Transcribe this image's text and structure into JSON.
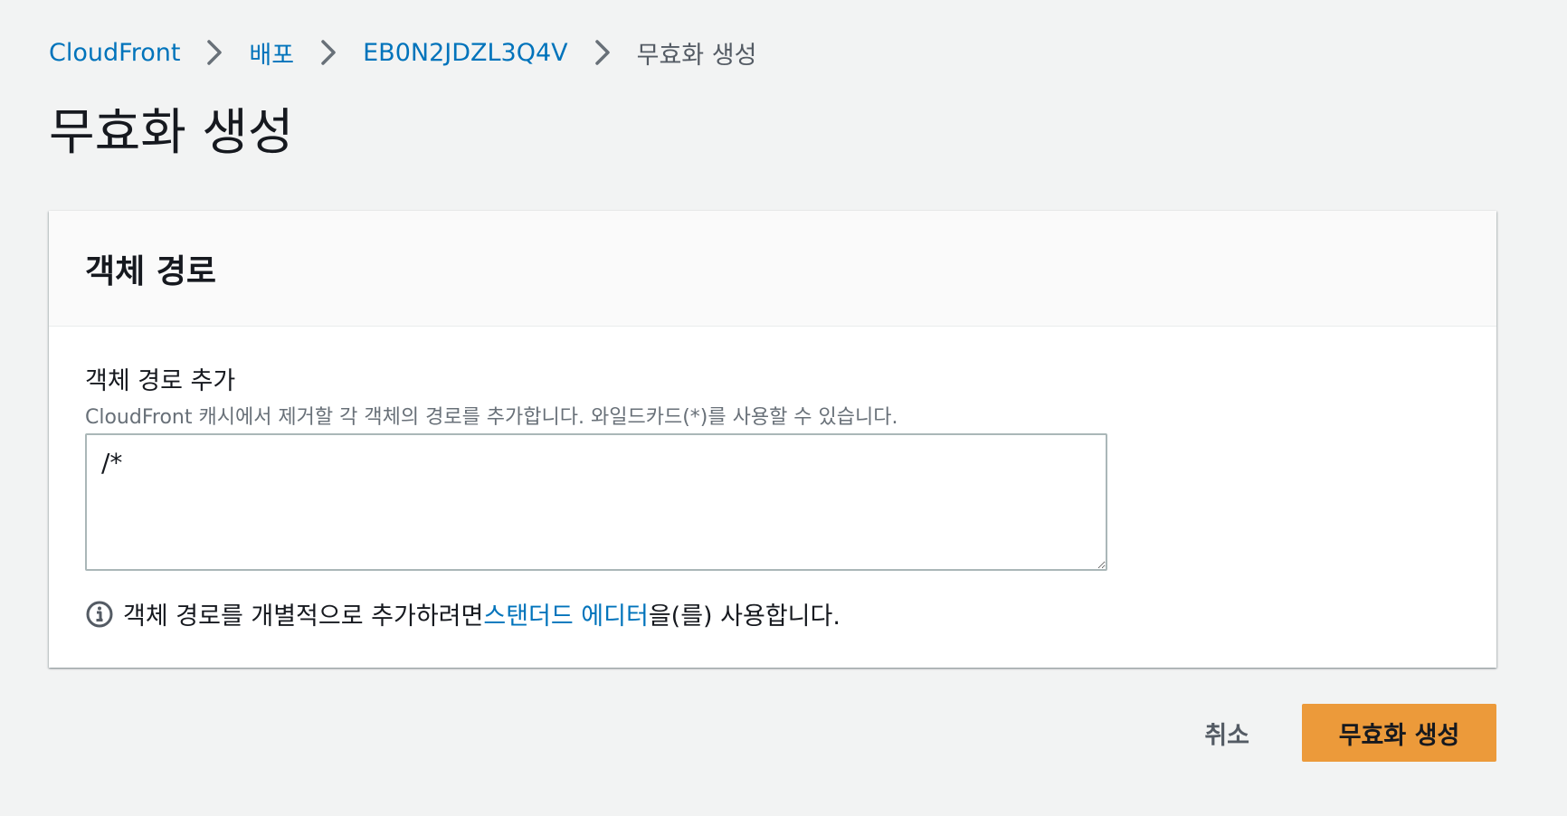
{
  "breadcrumb": {
    "items": [
      {
        "label": "CloudFront"
      },
      {
        "label": "배포"
      },
      {
        "label": "EB0N2JDZL3Q4V"
      }
    ],
    "current": "무효화 생성"
  },
  "page": {
    "title": "무효화 생성"
  },
  "panel": {
    "title": "객체 경로",
    "field_label": "객체 경로 추가",
    "field_description": "CloudFront 캐시에서 제거할 각 객체의 경로를 추가합니다. 와일드카드(*)를 사용할 수 있습니다.",
    "textarea_value": "/*",
    "hint_prefix": "객체 경로를 개별적으로 추가하려면 ",
    "hint_link": "스탠더드 에디터",
    "hint_suffix": "을(를) 사용합니다."
  },
  "actions": {
    "cancel_label": "취소",
    "submit_label": "무효화 생성"
  },
  "colors": {
    "accent": "#ec9a3a",
    "link": "#0073bb",
    "background": "#f2f3f3"
  },
  "icons": {
    "separator": "chevron-right-icon",
    "info": "info-icon"
  }
}
